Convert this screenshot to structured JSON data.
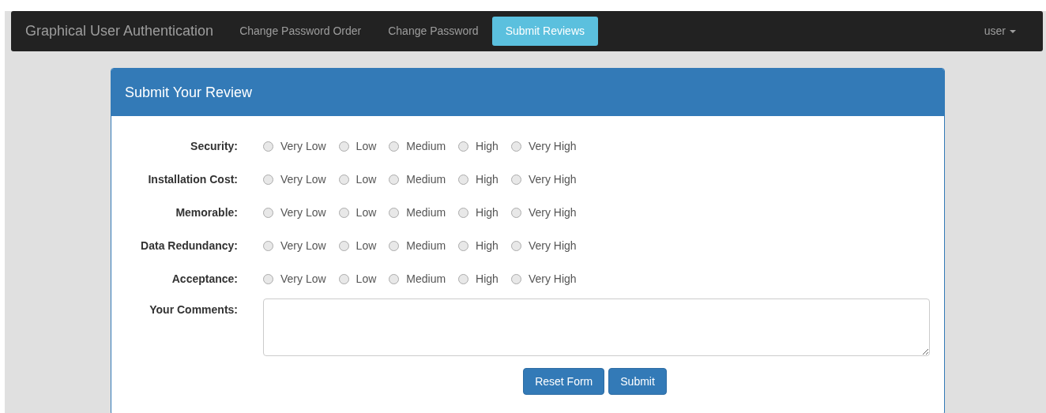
{
  "navbar": {
    "brand": "Graphical User Authentication",
    "links": [
      {
        "label": "Change Password Order",
        "selected": false
      },
      {
        "label": "Change Password",
        "selected": false
      },
      {
        "label": "Submit Reviews",
        "selected": true
      }
    ],
    "user_menu": {
      "label": "user"
    }
  },
  "panel": {
    "title": "Submit Your Review",
    "criteria": [
      {
        "label": "Security:",
        "options": [
          {
            "label": "Very Low",
            "selected": false
          },
          {
            "label": "Low",
            "selected": false
          },
          {
            "label": "Medium",
            "selected": false
          },
          {
            "label": "High",
            "selected": false
          },
          {
            "label": "Very High",
            "selected": false
          }
        ]
      },
      {
        "label": "Installation Cost:",
        "options": [
          {
            "label": "Very Low",
            "selected": false
          },
          {
            "label": "Low",
            "selected": false
          },
          {
            "label": "Medium",
            "selected": false
          },
          {
            "label": "High",
            "selected": false
          },
          {
            "label": "Very High",
            "selected": false
          }
        ]
      },
      {
        "label": "Memorable:",
        "options": [
          {
            "label": "Very Low",
            "selected": false
          },
          {
            "label": "Low",
            "selected": false
          },
          {
            "label": "Medium",
            "selected": false
          },
          {
            "label": "High",
            "selected": false
          },
          {
            "label": "Very High",
            "selected": false
          }
        ]
      },
      {
        "label": "Data Redundancy:",
        "options": [
          {
            "label": "Very Low",
            "selected": false
          },
          {
            "label": "Low",
            "selected": false
          },
          {
            "label": "Medium",
            "selected": false
          },
          {
            "label": "High",
            "selected": false
          },
          {
            "label": "Very High",
            "selected": false
          }
        ]
      },
      {
        "label": "Acceptance:",
        "options": [
          {
            "label": "Very Low",
            "selected": false
          },
          {
            "label": "Low",
            "selected": false
          },
          {
            "label": "Medium",
            "selected": false
          },
          {
            "label": "High",
            "selected": false
          },
          {
            "label": "Very High",
            "selected": false
          }
        ]
      }
    ],
    "comments": {
      "label": "Your Comments:"
    },
    "buttons": [
      "Reset Form",
      "Submit"
    ]
  }
}
